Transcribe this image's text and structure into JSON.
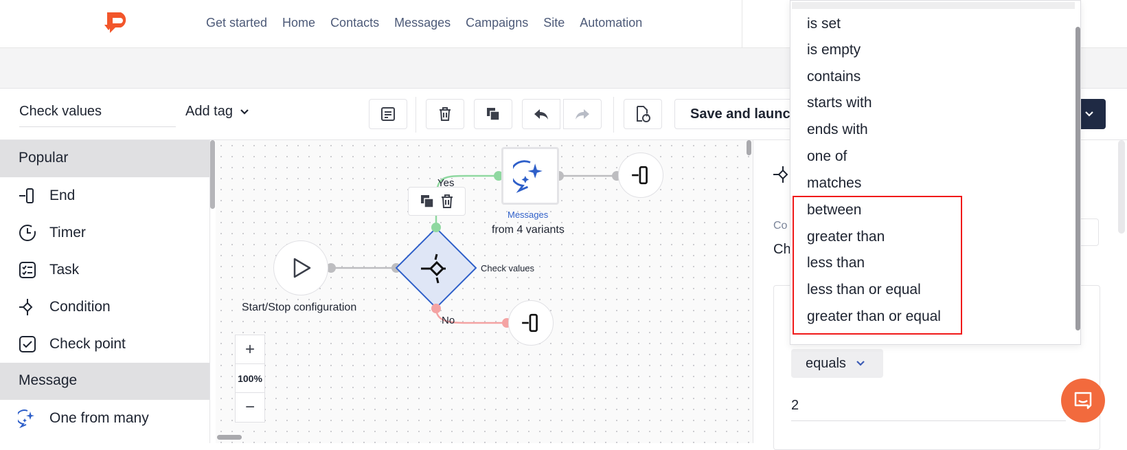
{
  "nav": {
    "items": [
      "Get started",
      "Home",
      "Contacts",
      "Messages",
      "Campaigns",
      "Site",
      "Automation"
    ]
  },
  "toolbar": {
    "name_value": "Check values",
    "add_tag_label": "Add tag",
    "save_label": "Save and launch"
  },
  "sidebar": {
    "sections": [
      {
        "title": "Popular",
        "items": [
          {
            "label": "End",
            "icon": "end-icon"
          },
          {
            "label": "Timer",
            "icon": "timer-icon"
          },
          {
            "label": "Task",
            "icon": "task-icon"
          },
          {
            "label": "Condition",
            "icon": "condition-icon"
          },
          {
            "label": "Check point",
            "icon": "check-point-icon"
          }
        ]
      },
      {
        "title": "Message",
        "items": [
          {
            "label": "One from many",
            "icon": "sparkle-chat-icon"
          }
        ]
      }
    ]
  },
  "canvas": {
    "start_label": "Start/Stop configuration",
    "condition_label": "Check values",
    "yes_label": "Yes",
    "no_label": "No",
    "messages_title": "Messages",
    "messages_sub": "from 4 variants",
    "zoom": {
      "plus": "+",
      "level": "100%",
      "minus": "−"
    }
  },
  "right_panel": {
    "label_partial": "Co",
    "sub_partial": "Ch",
    "operator_value": "equals",
    "value": "2"
  },
  "dropdown": {
    "options": [
      "is set",
      "is empty",
      "contains",
      "starts with",
      "ends with",
      "one of",
      "matches",
      "between",
      "greater than",
      "less than",
      "less than or equal",
      "greater than or equal"
    ],
    "highlighted": [
      "between",
      "greater than",
      "less than",
      "less than or equal",
      "greater than or equal"
    ]
  },
  "colors": {
    "accent": "#f26a3d",
    "highlight": "#f01818",
    "nav_text": "#4d5a78",
    "dark_button": "#1f2a44",
    "condition_node": "#dfe6f6"
  }
}
